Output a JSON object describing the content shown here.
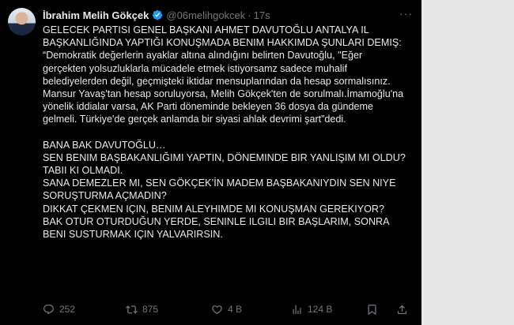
{
  "author": {
    "name": "İbrahim Melih Gökçek",
    "handle": "@06melihgokcek",
    "separator": "·",
    "time": "17s"
  },
  "icons": {
    "verified": "verified-badge-icon",
    "more": "more-icon",
    "reply": "reply-icon",
    "retweet": "retweet-icon",
    "like": "heart-icon",
    "views": "views-icon",
    "bookmark": "bookmark-icon",
    "share": "share-icon"
  },
  "colors": {
    "verified": "#1d9bf0",
    "text": "#e7e9ea",
    "muted": "#71767b",
    "background": "#000000"
  },
  "tweet": {
    "paragraph1": "GELECEK PARTISI GENEL BAŞKANI AHMET DAVUTOĞLU ANTALYA IL BAŞKANLIĞINDA YAPTIĞI KONUŞMADA BENIM HAKKIMDA ŞUNLARI DEMIŞ:\n“Demokratik değerlerin ayaklar altına alındığını belirten Davutoğlu, \"Eğer gerçekten yolsuzluklarla mücadele etmek istiyorsamz sadece muhalif belediyelerden değil, geçmişteki iktidar mensuplarından da hesap sormalısınız. Mansur Yavaş'tan hesap soruluyorsa, Melih Gökçek'ten de sorulmalı.İmamoğlu'na yönelik iddialar varsa, AK Parti döneminde bekleyen 36 dosya da gündeme gelmeli. Türkiye'de gerçek anlamda bir siyasi ahlak devrimi şart”dedi.",
    "paragraph2": "BANA BAK DAVUTOĞLU…\nSEN BENIM BAŞBAKANLIĞIMI YAPTIN, DÖNEMINDE BIR YANLIŞIM MI OLDU? TABII KI OLMADI.\nSANA DEMEZLER MI, SEN GÖKÇEK’İN MADEM BAŞBAKANIYDIN SEN NIYE SORUŞTURMA AÇMADIN?\nDIKKAT ÇEKMEN IÇIN, BENIM ALEYHIMDE MI KONUŞMAN GEREKIYOR?\nBAK OTUR OTURDUĞUN YERDE, SENINLE ILGILI BIR BAŞLARIM, SONRA BENI SUSTURMAK IÇIN YALVARIRSIN."
  },
  "stats": {
    "replies": "252",
    "retweets": "875",
    "likes": "4 B",
    "views": "124 B"
  }
}
